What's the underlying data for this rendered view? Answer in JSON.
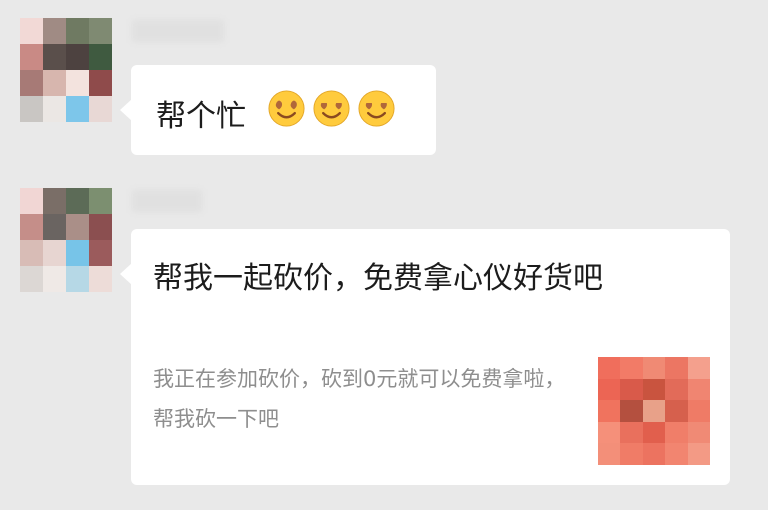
{
  "messages": [
    {
      "text": "帮个忙",
      "emojis": [
        "heart-eyes-emoji",
        "heart-eyes-emoji",
        "heart-eyes-emoji"
      ]
    },
    {
      "share_card": {
        "title": "帮我一起砍价，免费拿心仪好货吧",
        "description": "我正在参加砍价，砍到0元就可以免费拿啦，帮我砍一下吧"
      }
    }
  ],
  "colors": {
    "background": "#e9e9e9",
    "bubble": "#ffffff",
    "primary_text": "#1c1c1c",
    "secondary_text": "#8e8e8e"
  }
}
